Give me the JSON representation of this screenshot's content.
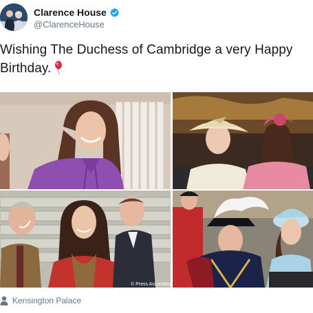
{
  "author": {
    "display_name": "Clarence House",
    "handle": "@ClarenceHouse",
    "verified_icon": "verified-badge-icon",
    "avatar_icon": "profile-photo"
  },
  "tweet": {
    "text": "Wishing The Duchess of Cambridge a very Happy Birthday.",
    "emoji_icon": "balloon-icon"
  },
  "media": {
    "photo_count": 4,
    "credit": "© Press Association"
  },
  "location": {
    "icon": "person-icon",
    "label": "Kensington Palace"
  },
  "colors": {
    "text": "#14171a",
    "secondary": "#657786",
    "verified": "#1da1f2",
    "balloon": "#e0245e"
  }
}
